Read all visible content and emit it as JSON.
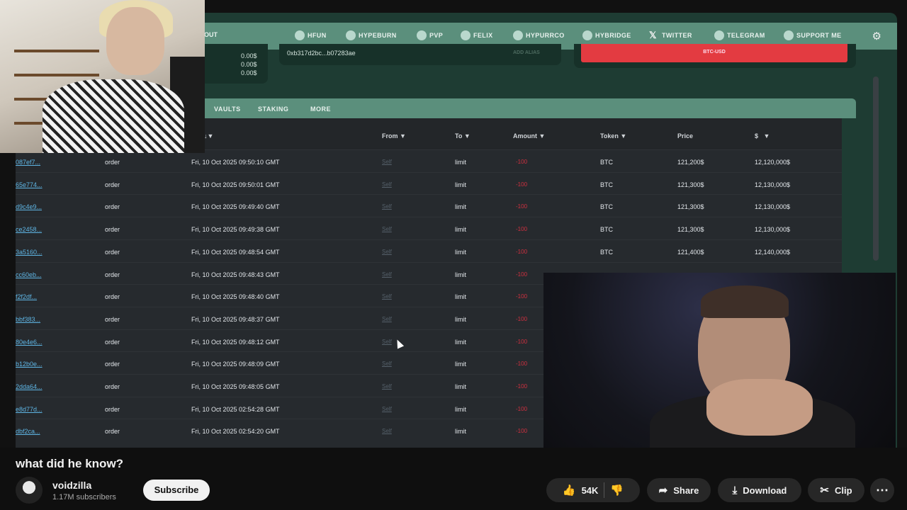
{
  "video_title": "what did he know?",
  "channel": {
    "name": "voidzilla",
    "subscribers": "1.17M subscribers",
    "subscribe_label": "Subscribe"
  },
  "actions": {
    "likes": "54K",
    "share_label": "Share",
    "download_label": "Download",
    "clip_label": "Clip",
    "more_glyph": "⋯"
  },
  "site": {
    "nav_partial": "OUT",
    "nav": [
      {
        "label": "HFUN",
        "icon": "hfun-icon"
      },
      {
        "label": "HYPEBURN",
        "icon": "cat-icon"
      },
      {
        "label": "PVP",
        "icon": "skull-icon"
      },
      {
        "label": "FELIX",
        "icon": "felix-icon"
      },
      {
        "label": "HYPURRCO",
        "icon": "hypurrco-icon"
      },
      {
        "label": "HYBRIDGE",
        "icon": "bridge-icon"
      },
      {
        "label": "TWITTER",
        "icon": "x-icon"
      },
      {
        "label": "TELEGRAM",
        "icon": "telegram-icon"
      },
      {
        "label": "SUPPORT ME",
        "icon": "support-icon"
      }
    ],
    "balances": [
      "0.00$",
      "0.00$",
      "0.00$"
    ],
    "address": "0xb317d2bc...b07283ae",
    "add_alias": "ADD ALIAS",
    "pair_button": "BTC-USD",
    "tabs": [
      "VAULTS",
      "STAKING",
      "MORE"
    ],
    "columns": [
      "From",
      "To",
      "Amount",
      "Token",
      "Price",
      "$"
    ],
    "rows": [
      {
        "hash": "087ef7...",
        "type": "order",
        "time": "Fri, 10 Oct 2025 09:50:10 GMT",
        "from": "Self",
        "to": "limit",
        "amount": "-100",
        "token": "BTC",
        "price": "121,200$",
        "usd": "12,120,000$"
      },
      {
        "hash": "65e774...",
        "type": "order",
        "time": "Fri, 10 Oct 2025 09:50:01 GMT",
        "from": "Self",
        "to": "limit",
        "amount": "-100",
        "token": "BTC",
        "price": "121,300$",
        "usd": "12,130,000$"
      },
      {
        "hash": "d9c4e9...",
        "type": "order",
        "time": "Fri, 10 Oct 2025 09:49:40 GMT",
        "from": "Self",
        "to": "limit",
        "amount": "-100",
        "token": "BTC",
        "price": "121,300$",
        "usd": "12,130,000$"
      },
      {
        "hash": "ce2458...",
        "type": "order",
        "time": "Fri, 10 Oct 2025 09:49:38 GMT",
        "from": "Self",
        "to": "limit",
        "amount": "-100",
        "token": "BTC",
        "price": "121,300$",
        "usd": "12,130,000$"
      },
      {
        "hash": "3a5160...",
        "type": "order",
        "time": "Fri, 10 Oct 2025 09:48:54 GMT",
        "from": "Self",
        "to": "limit",
        "amount": "-100",
        "token": "BTC",
        "price": "121,400$",
        "usd": "12,140,000$"
      },
      {
        "hash": "cc60eb...",
        "type": "order",
        "time": "Fri, 10 Oct 2025 09:48:43 GMT",
        "from": "Self",
        "to": "limit",
        "amount": "-100",
        "token": "",
        "price": "",
        "usd": ""
      },
      {
        "hash": "f2f2df...",
        "type": "order",
        "time": "Fri, 10 Oct 2025 09:48:40 GMT",
        "from": "Self",
        "to": "limit",
        "amount": "-100",
        "token": "",
        "price": "",
        "usd": ""
      },
      {
        "hash": "bbf383...",
        "type": "order",
        "time": "Fri, 10 Oct 2025 09:48:37 GMT",
        "from": "Self",
        "to": "limit",
        "amount": "-100",
        "token": "",
        "price": "",
        "usd": ""
      },
      {
        "hash": "80e4e6...",
        "type": "order",
        "time": "Fri, 10 Oct 2025 09:48:12 GMT",
        "from": "Self",
        "to": "limit",
        "amount": "-100",
        "token": "",
        "price": "",
        "usd": ""
      },
      {
        "hash": "b12b0e...",
        "type": "order",
        "time": "Fri, 10 Oct 2025 09:48:09 GMT",
        "from": "Self",
        "to": "limit",
        "amount": "-100",
        "token": "",
        "price": "",
        "usd": ""
      },
      {
        "hash": "2dda64...",
        "type": "order",
        "time": "Fri, 10 Oct 2025 09:48:05 GMT",
        "from": "Self",
        "to": "limit",
        "amount": "-100",
        "token": "",
        "price": "",
        "usd": ""
      },
      {
        "hash": "e8d77d...",
        "type": "order",
        "time": "Fri, 10 Oct 2025 02:54:28 GMT",
        "from": "Self",
        "to": "limit",
        "amount": "-100",
        "token": "",
        "price": "",
        "usd": ""
      },
      {
        "hash": "dbf2ca...",
        "type": "order",
        "time": "Fri, 10 Oct 2025 02:54:20 GMT",
        "from": "Self",
        "to": "limit",
        "amount": "-100",
        "token": "",
        "price": "",
        "usd": ""
      }
    ]
  },
  "colors": {
    "site_green": "#5b8f7c",
    "site_dark": "#1e3c33",
    "red_button": "#e33b41",
    "link_blue": "#5fb6e5"
  }
}
